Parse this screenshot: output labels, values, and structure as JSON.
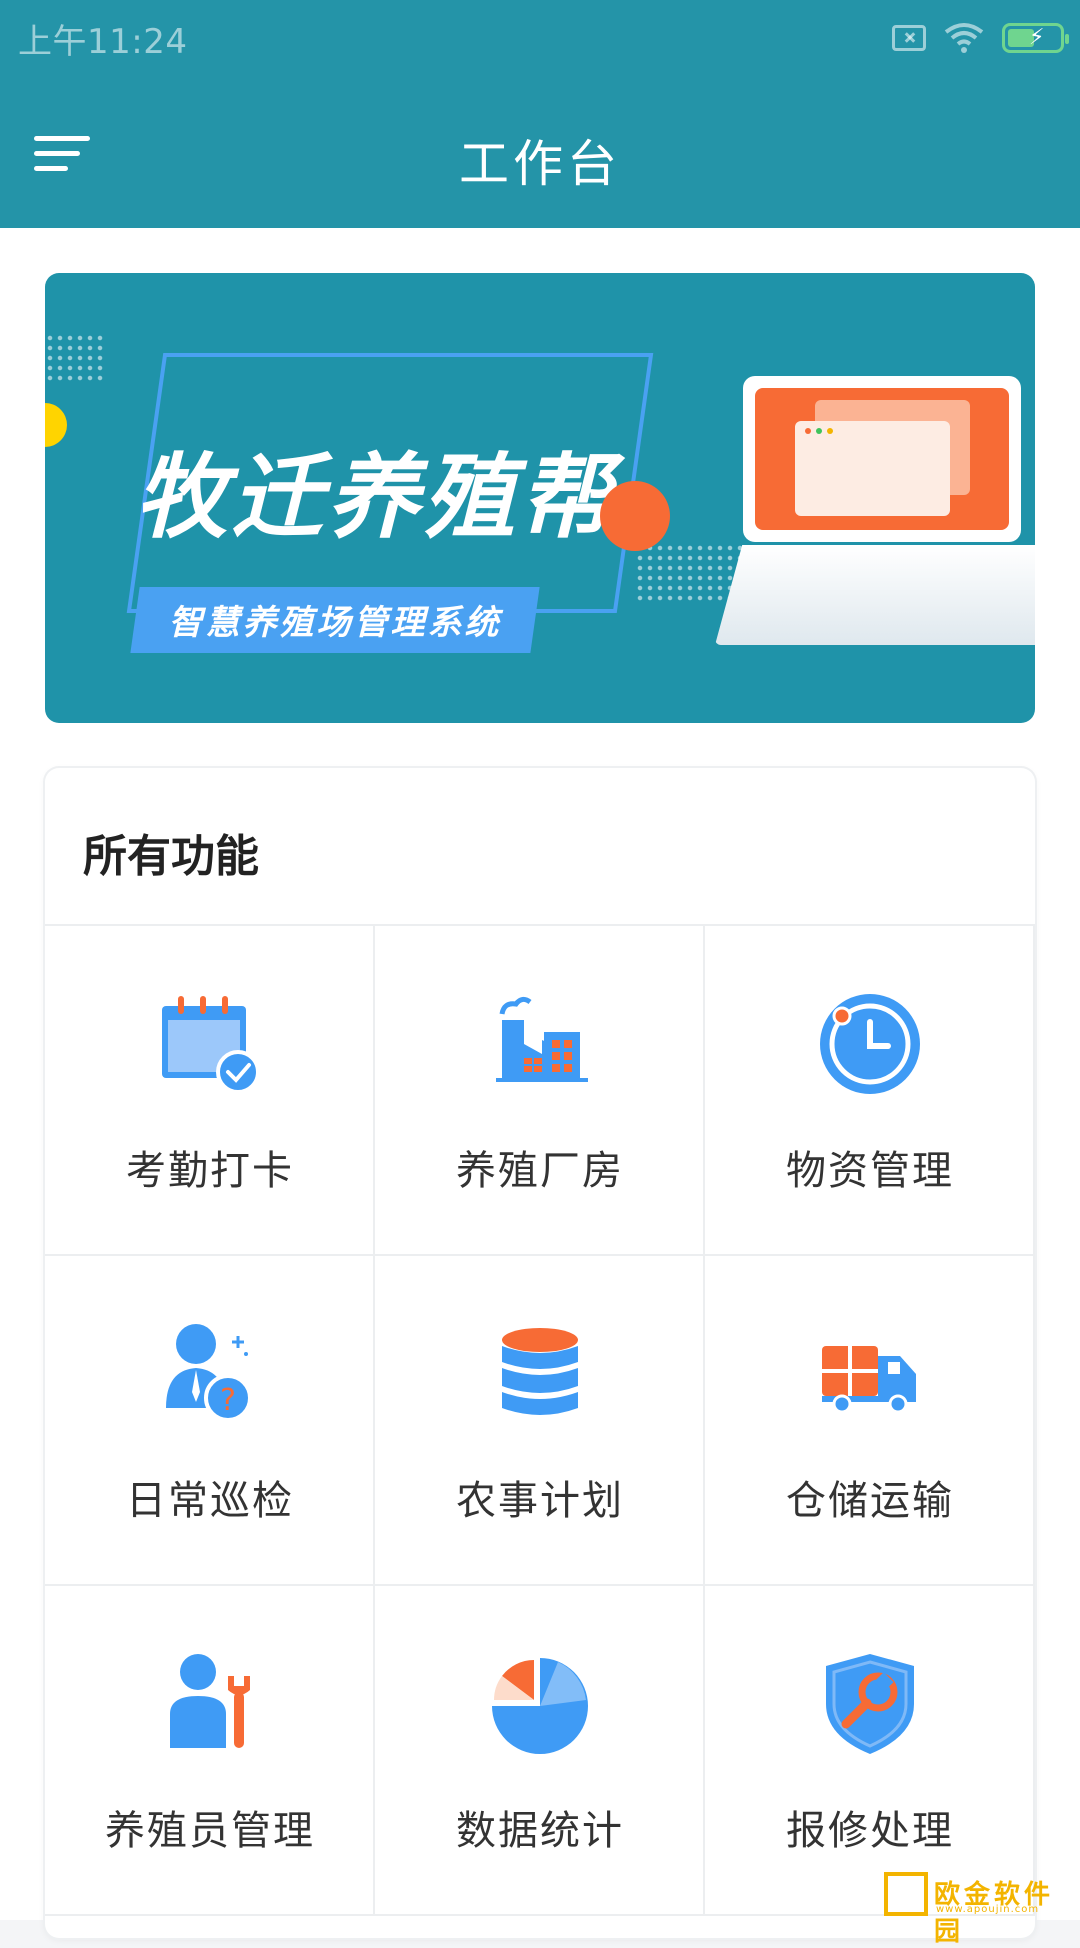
{
  "status_bar": {
    "time": "上午11:24"
  },
  "header": {
    "title": "工作台"
  },
  "banner": {
    "title": "牧迁养殖帮",
    "subtitle": "智慧养殖场管理系统"
  },
  "features": {
    "section_title": "所有功能",
    "items": [
      {
        "label": "考勤打卡",
        "icon": "calendar-check-icon"
      },
      {
        "label": "养殖厂房",
        "icon": "factory-icon"
      },
      {
        "label": "物资管理",
        "icon": "clock-icon"
      },
      {
        "label": "日常巡检",
        "icon": "inspector-question-icon"
      },
      {
        "label": "农事计划",
        "icon": "database-icon"
      },
      {
        "label": "仓储运输",
        "icon": "delivery-truck-icon"
      },
      {
        "label": "养殖员管理",
        "icon": "worker-wrench-icon"
      },
      {
        "label": "数据统计",
        "icon": "pie-chart-icon"
      },
      {
        "label": "报修处理",
        "icon": "shield-wrench-icon"
      }
    ]
  },
  "watermark": {
    "text": "欧金软件园",
    "url_text": "www.apoujin.com"
  },
  "colors": {
    "header": "#2494a8",
    "icon_blue": "#3f9bf5",
    "icon_orange": "#f76b35"
  }
}
